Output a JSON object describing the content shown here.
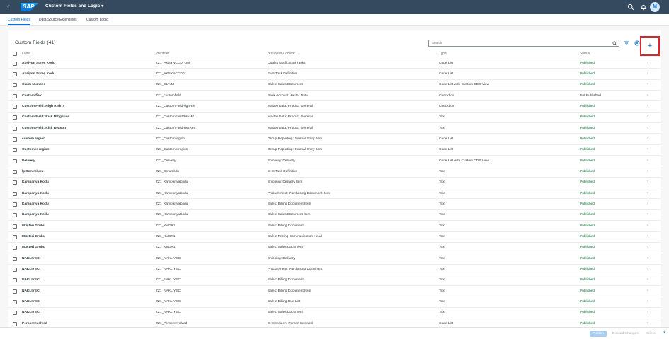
{
  "shell": {
    "back_icon": "back-icon",
    "logo": "SAP",
    "title": "Custom Fields and Logic",
    "title_caret": "▾",
    "avatar": "M"
  },
  "tabs": [
    {
      "label": "Custom Fields",
      "active": true
    },
    {
      "label": "Data Source Extensions",
      "active": false
    },
    {
      "label": "Custom Logic",
      "active": false
    }
  ],
  "table": {
    "title": "Custom Fields (41)",
    "search_placeholder": "Search",
    "add_label": "+",
    "columns": [
      "Label",
      "Identifier",
      "Business Context",
      "Type",
      "Status"
    ],
    "rows": [
      {
        "label": "Aksiyon Süreç Kodu",
        "id": "ZZ1_AKSYNCCD_QM",
        "bc": "Quality Notification Tasks",
        "type": "Code List",
        "status": "Published"
      },
      {
        "label": "Aksiyon Süreç Kodu",
        "id": "ZZ1_AKSYNCCD0",
        "bc": "EHS Task Definition",
        "type": "Code List",
        "status": "Published"
      },
      {
        "label": "Claim Number",
        "id": "ZZ1_CLAIM",
        "bc": "Sales: Sales Document",
        "type": "Code List with Custom CDS View",
        "status": "Published"
      },
      {
        "label": "Custom field",
        "id": "ZZ1_customfield",
        "bc": "Bank Account Master Data",
        "type": "Checkbox",
        "status": "Not Published"
      },
      {
        "label": "Custom Field: High Risk ?",
        "id": "ZZ1_CustomFieldHighRis",
        "bc": "Master Data: Product General",
        "type": "Checkbox",
        "status": "Published"
      },
      {
        "label": "Custom Field: Risk Mitigation",
        "id": "ZZ1_CustomFieldRiskMit",
        "bc": "Master Data: Product General",
        "type": "Text",
        "status": "Published"
      },
      {
        "label": "Custom Field: Risk Reason",
        "id": "ZZ1_CustomFieldRiskRea",
        "bc": "Master Data: Product General",
        "type": "Text",
        "status": "Published"
      },
      {
        "label": "custom region",
        "id": "ZZ1_Customregion",
        "bc": "Group Reporting: Journal Entry Item",
        "type": "Code List",
        "status": "Published"
      },
      {
        "label": "Customer region",
        "id": "ZZ1_Customerregion",
        "bc": "Group Reporting: Journal Entry Item",
        "type": "Code List",
        "status": "Published"
      },
      {
        "label": "Delivery",
        "id": "ZZ1_Delivery",
        "bc": "Shipping: Delivery",
        "type": "Code List with Custom CDS View",
        "status": "Published"
      },
      {
        "label": "İş Sorumlusu",
        "id": "ZZ1_Sorumlulu",
        "bc": "EHS Task Definition",
        "type": "Text",
        "status": "Published"
      },
      {
        "label": "Kampanya Kodu",
        "id": "ZZ1_KampanyaKodu",
        "bc": "Shipping: Delivery Item",
        "type": "Text",
        "status": "Published"
      },
      {
        "label": "Kampanya Kodu",
        "id": "ZZ1_KampanyaKodu",
        "bc": "Procurement: Purchasing Document Item",
        "type": "Text",
        "status": "Published"
      },
      {
        "label": "Kampanya Kodu",
        "id": "ZZ1_KampanyaKodu",
        "bc": "Sales: Billing Document Item",
        "type": "Text",
        "status": "Published"
      },
      {
        "label": "Kampanya Kodu",
        "id": "ZZ1_KampanyaKodu",
        "bc": "Sales: Sales Document Item",
        "type": "Text",
        "status": "Published"
      },
      {
        "label": "Müşteri Grubu",
        "id": "ZZ1_KVGR1",
        "bc": "Sales: Billing Document",
        "type": "Text",
        "status": "Published"
      },
      {
        "label": "Müşteri Grubu",
        "id": "ZZ1_KVGR1",
        "bc": "Sales: Pricing Communication Head",
        "type": "Text",
        "status": "Published"
      },
      {
        "label": "Müşteri Grubu",
        "id": "ZZ1_KVGR1",
        "bc": "Sales: Sales Document",
        "type": "Text",
        "status": "Published"
      },
      {
        "label": "NAKLIYECI",
        "id": "ZZ1_NAKLIYECI",
        "bc": "Shipping: Delivery",
        "type": "Text",
        "status": "Published"
      },
      {
        "label": "NAKLIYECI",
        "id": "ZZ1_NAKLIYECI",
        "bc": "Procurement: Purchasing Document",
        "type": "Text",
        "status": "Published"
      },
      {
        "label": "NAKLIYECI",
        "id": "ZZ1_NAKLIYECI",
        "bc": "Sales: Billing Document",
        "type": "Text",
        "status": "Published"
      },
      {
        "label": "NAKLIYECI",
        "id": "ZZ1_NAKLIYECI",
        "bc": "Sales: Billing Document Item",
        "type": "Text",
        "status": "Published"
      },
      {
        "label": "NAKLIYECI",
        "id": "ZZ1_NAKLIYECI",
        "bc": "Sales: Billing Due List",
        "type": "Text",
        "status": "Published"
      },
      {
        "label": "NAKLIYECI",
        "id": "ZZ1_NAKLIYECI",
        "bc": "Sales: Sales Document",
        "type": "Text",
        "status": "Published"
      },
      {
        "label": "PersonInvolved",
        "id": "ZZ1_PersonInvolved",
        "bc": "EHS Incident Person Involved",
        "type": "Code List",
        "status": "Published"
      }
    ]
  },
  "footer": {
    "publish": "Publish",
    "discard": "Discard Changes",
    "delete": "Delete"
  },
  "colors": {
    "shell": "#354a5f",
    "accent": "#0a6ed1",
    "published": "#107e3e",
    "highlight": "#d9262b"
  }
}
